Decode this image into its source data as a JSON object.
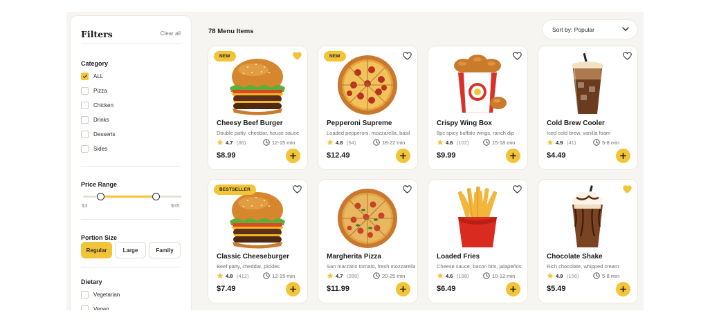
{
  "filters": {
    "title": "Filters",
    "clear_label": "Clear all",
    "category": {
      "title": "Category",
      "items": [
        {
          "label": "ALL",
          "checked": true
        },
        {
          "label": "Pizza",
          "checked": false
        },
        {
          "label": "Chicken",
          "checked": false
        },
        {
          "label": "Drinks",
          "checked": false
        },
        {
          "label": "Desserts",
          "checked": false
        },
        {
          "label": "Sides",
          "checked": false
        }
      ]
    },
    "price_range": {
      "title": "Price Range",
      "min_label": "$3",
      "max_label": "$35",
      "low_fraction": 0.18,
      "high_fraction": 0.74
    },
    "portion_size": {
      "title": "Portion Size",
      "options": [
        "Regular",
        "Large",
        "Family"
      ],
      "selected": "Regular"
    },
    "dietary": {
      "title": "Dietary",
      "items": [
        {
          "label": "Vegetarian",
          "checked": false
        },
        {
          "label": "Vegan",
          "checked": false
        }
      ]
    }
  },
  "main": {
    "count_label": "78 Menu Items",
    "sort_label": "Sort by: Popular",
    "cards": [
      {
        "badge": "NEW",
        "favorited": true,
        "food": "burger",
        "name": "Cheesy Beef Burger",
        "desc": "Double patty, cheddar, house sauce",
        "rating": "4.7",
        "reviews": "(86)",
        "time": "12-15 min",
        "price": "$8.99"
      },
      {
        "badge": "NEW",
        "favorited": false,
        "food": "pizza",
        "name": "Pepperoni Supreme",
        "desc": "Loaded pepperoni, mozzarella, basil",
        "rating": "4.8",
        "reviews": "(64)",
        "time": "18-22 min",
        "price": "$12.49"
      },
      {
        "badge": "",
        "favorited": false,
        "food": "chicken",
        "name": "Crispy Wing Box",
        "desc": "8pc spicy buffalo wings, ranch dip",
        "rating": "4.6",
        "reviews": "(102)",
        "time": "15-18 min",
        "price": "$9.99"
      },
      {
        "badge": "",
        "favorited": false,
        "food": "coffee",
        "name": "Cold Brew Cooler",
        "desc": "Iced cold brew, vanilla foam",
        "rating": "4.9",
        "reviews": "(41)",
        "time": "5-8 min",
        "price": "$4.49"
      },
      {
        "badge": "BESTSELLER",
        "favorited": false,
        "food": "burger",
        "name": "Classic Cheeseburger",
        "desc": "Beef patty, cheddar, pickles",
        "rating": "4.8",
        "reviews": "(412)",
        "time": "12-15 min",
        "price": "$7.49"
      },
      {
        "badge": "",
        "favorited": false,
        "food": "pizza2",
        "name": "Margherita Pizza",
        "desc": "San marzano tomato, fresh mozzarella",
        "rating": "4.7",
        "reviews": "(289)",
        "time": "20-25 min",
        "price": "$11.99"
      },
      {
        "badge": "",
        "favorited": false,
        "food": "fries",
        "name": "Loaded Fries",
        "desc": "Cheese sauce, bacon bits, jalapeños",
        "rating": "4.6",
        "reviews": "(198)",
        "time": "10-12 min",
        "price": "$6.49"
      },
      {
        "badge": "",
        "favorited": true,
        "food": "shake",
        "name": "Chocolate Shake",
        "desc": "Rich chocolate, whipped cream",
        "rating": "4.9",
        "reviews": "(156)",
        "time": "5-8 min",
        "price": "$5.49"
      }
    ]
  },
  "colors": {
    "accent": "#f2c437",
    "background": "#f6f5f1",
    "card": "#ffffff"
  },
  "icons": {
    "favorite": "heart-icon",
    "rating": "star-icon",
    "time": "clock-icon",
    "add": "plus-icon",
    "sort": "chevron-down-icon"
  }
}
